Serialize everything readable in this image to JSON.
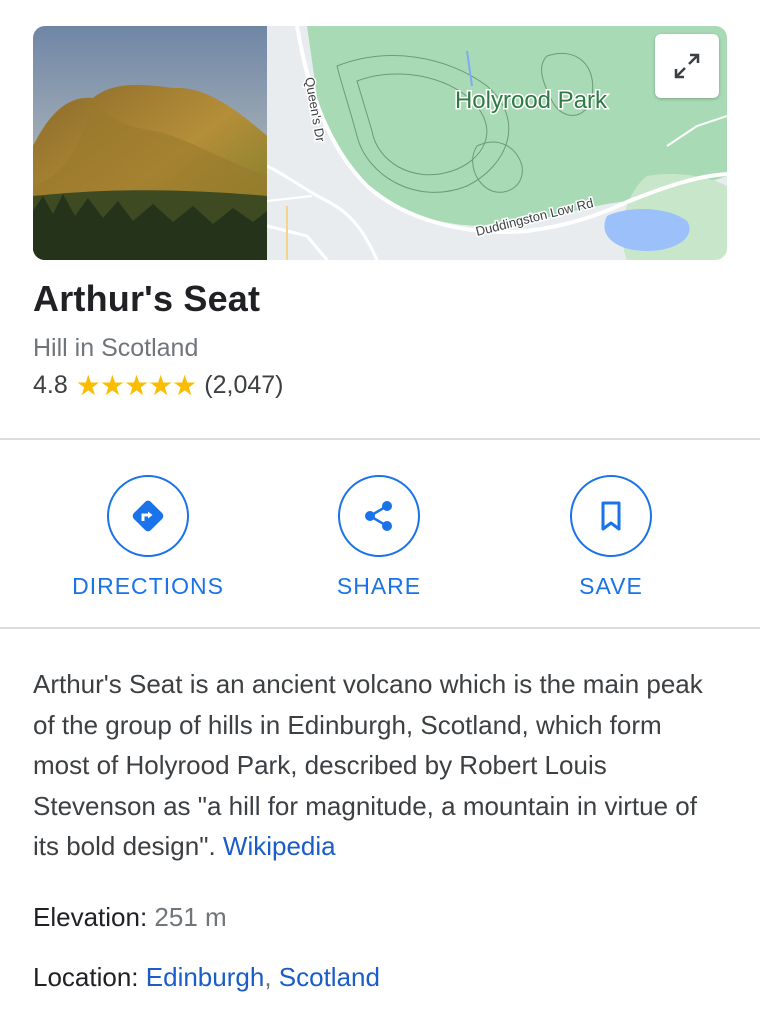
{
  "place": {
    "title": "Arthur's Seat",
    "subtitle": "Hill in Scotland",
    "rating": "4.8",
    "stars": "★★★★★",
    "review_count": "(2,047)"
  },
  "map": {
    "park_label": "Holyrood Park",
    "road_1": "Queen's Dr",
    "road_2": "Duddingston Low Rd"
  },
  "actions": [
    {
      "label": "DIRECTIONS"
    },
    {
      "label": "SHARE"
    },
    {
      "label": "SAVE"
    }
  ],
  "description": {
    "text": "Arthur's Seat is an ancient volcano which is the main peak of the group of hills in Edinburgh, Scotland, which form most of Holyrood Park, described by Robert Louis Stevenson as \"a hill for magnitude, a mountain in virtue of its bold design\". ",
    "source_link": "Wikipedia"
  },
  "facts": {
    "elevation_label": "Elevation:",
    "elevation_value": "251 m",
    "location_label": "Location:",
    "location_city": "Edinburgh",
    "location_sep": ", ",
    "location_country": "Scotland"
  },
  "colors": {
    "accent": "#1a73e8",
    "star": "#fbbc04",
    "park_green": "#a8dab5"
  }
}
